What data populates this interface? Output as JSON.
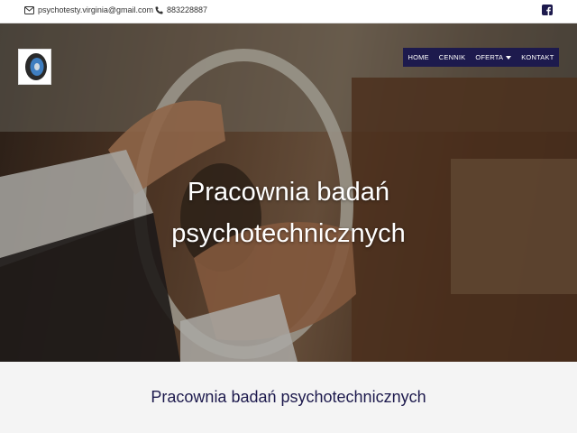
{
  "topbar": {
    "email": "psychotesty.virginia@gmail.com",
    "phone": "883228887",
    "email_icon": "envelope-icon",
    "phone_icon": "phone-icon",
    "social_icon": "facebook-icon"
  },
  "nav": {
    "items": [
      {
        "label": "HOME"
      },
      {
        "label": "CENNIK"
      },
      {
        "label": "OFERTA"
      },
      {
        "label": "KONTAKT"
      }
    ]
  },
  "hero": {
    "title_line1": "Pracownia badań",
    "title_line2": "psychotechnicznych",
    "slides_count": 2
  },
  "section": {
    "title": "Pracownia badań psychotechnicznych"
  },
  "colors": {
    "nav_bg": "#1d1a4d",
    "section_title": "#1d1a4d",
    "facebook": "#1d1a4d"
  }
}
